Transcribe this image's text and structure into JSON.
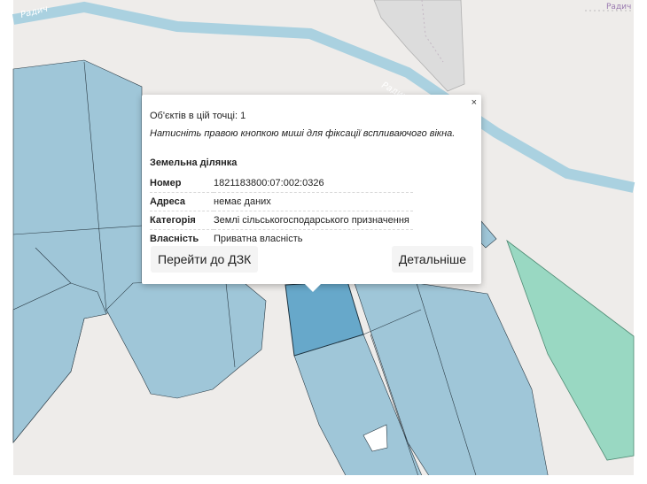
{
  "map": {
    "road_labels": [
      "Радич",
      "Радич"
    ],
    "place_label": "Радич",
    "colors": {
      "background": "#eeecea",
      "parcel": "#9fc6d8",
      "parcel_selected": "#67a8ca",
      "parcel_green": "#99d8c2",
      "grey_area": "#dcdcdc",
      "river": "#aad1e0"
    }
  },
  "popup": {
    "close_label": "×",
    "count_text": "Об'єктів в цій точці: 1",
    "hint_text": "Натисніть правою кнопкою миші для фіксації вспливаючого вікна.",
    "parcel_type": "Земельна ділянка",
    "rows": [
      {
        "key": "Номер",
        "value": "1821183800:07:002:0326"
      },
      {
        "key": "Адреса",
        "value": "немає даних"
      },
      {
        "key": "Категорія",
        "value": "Землі сільськогосподарського призначення"
      },
      {
        "key": "Власність",
        "value": "Приватна власність"
      }
    ],
    "go_button": "Перейти до ДЗК",
    "details_button": "Детальніше"
  }
}
